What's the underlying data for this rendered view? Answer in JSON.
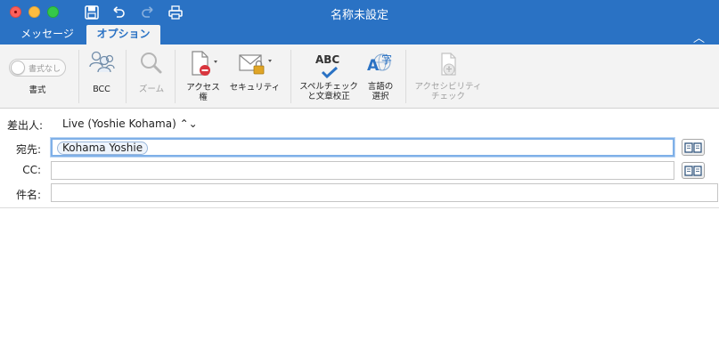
{
  "window": {
    "title": "名称未設定"
  },
  "tabs": [
    {
      "label": "メッセージ",
      "active": false
    },
    {
      "label": "オプション",
      "active": true
    }
  ],
  "colors": {
    "accent": "#2a72c4",
    "ribbon_bg": "#f3f3f3"
  },
  "ribbon": {
    "format_toggle": {
      "text": "書式なし",
      "label": "書式"
    },
    "bcc": {
      "label": "BCC",
      "icon": "people-icon"
    },
    "zoom": {
      "label": "ズーム",
      "icon": "magnifier-icon",
      "enabled": false
    },
    "access": {
      "label_line1": "アクセス",
      "label_line2": "権",
      "icon": "document-restricted-icon"
    },
    "security": {
      "label": "セキュリティ",
      "icon": "envelope-lock-icon"
    },
    "spell": {
      "icon_text": "ABC",
      "label_line1": "スペルチェック",
      "label_line2": "と文章校正"
    },
    "language": {
      "icon_text_1": "A",
      "icon_text_2": "字",
      "label_line1": "言語の",
      "label_line2": "選択"
    },
    "accessibility": {
      "label_line1": "アクセシビリティ",
      "label_line2": "チェック",
      "enabled": false
    }
  },
  "compose": {
    "from_label": "差出人:",
    "from_value": "Live (Yoshie Kohama) ⌃⌄",
    "to_label": "宛先:",
    "to_recipient": "Kohama Yoshie",
    "cc_label": "CC:",
    "subject_label": "件名:"
  }
}
